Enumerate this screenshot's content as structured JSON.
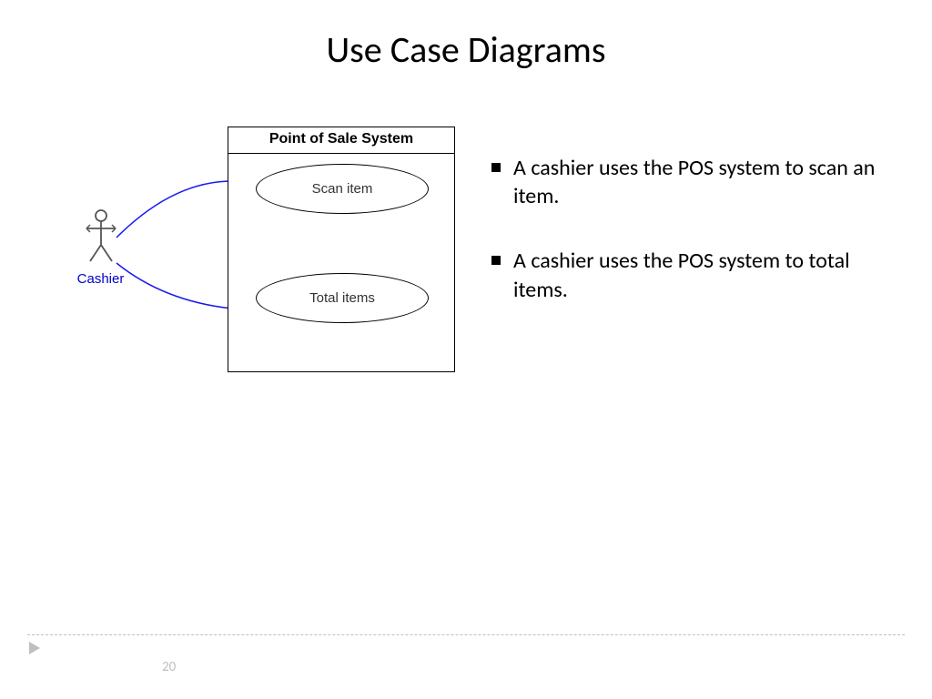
{
  "title": "Use Case Diagrams",
  "diagram": {
    "system_name": "Point of Sale System",
    "actor": "Cashier",
    "use_cases": [
      "Scan item",
      "Total items"
    ]
  },
  "bullets": [
    "A cashier uses the POS system to scan an item.",
    "A cashier uses the POS system to total items."
  ],
  "page_number": "20"
}
